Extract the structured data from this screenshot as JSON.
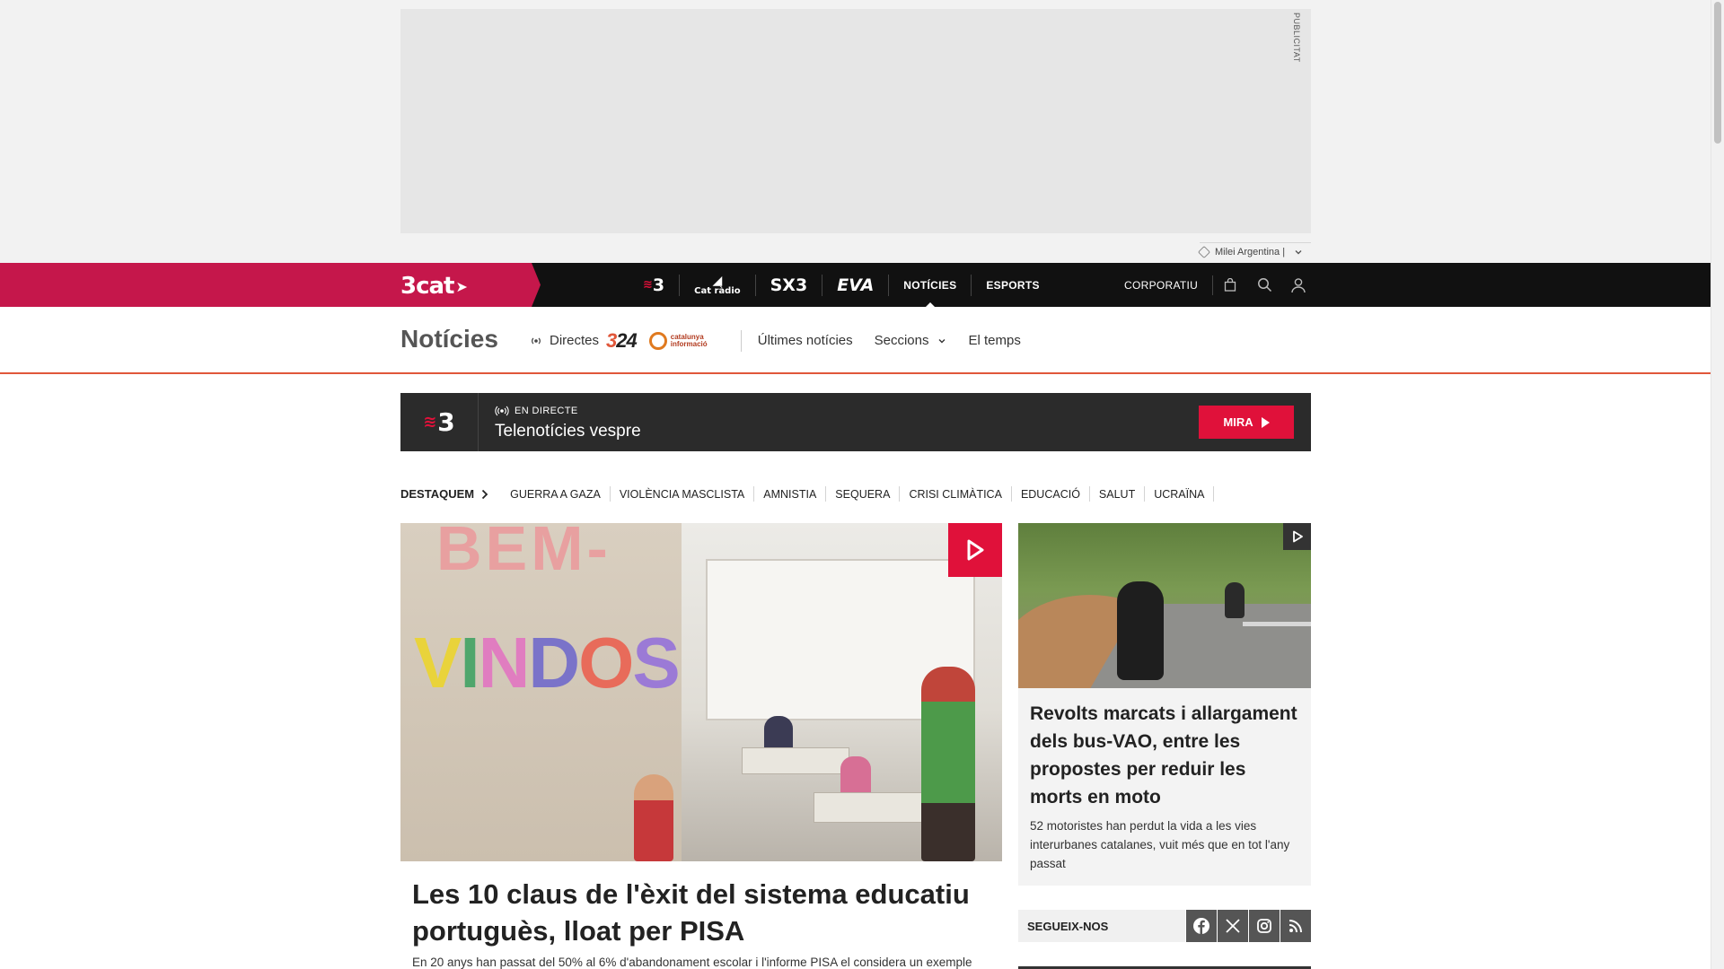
{
  "ad": {
    "label": "PUBLICITAT",
    "topic": "Milei Argentina |"
  },
  "topnav": {
    "brand": "3cat",
    "channels": [
      {
        "label": "3",
        "icon": "tv3-logo-icon"
      },
      {
        "label": "Cat ràdio",
        "icon": "catradio-logo-icon"
      },
      {
        "label": "SX3",
        "icon": "sx3-logo-icon"
      },
      {
        "label": "EVA",
        "icon": "eva-logo-icon"
      }
    ],
    "links": [
      {
        "label": "NOTÍCIES",
        "active": true
      },
      {
        "label": "ESPORTS",
        "active": false
      }
    ],
    "corporate": "CORPORATIU"
  },
  "section": {
    "title": "Notícies",
    "live_label": "Directes",
    "logo_324": "324",
    "logo_ci": "catalunya informació",
    "links": [
      "Últimes notícies",
      "Seccions",
      "El temps"
    ]
  },
  "live": {
    "channel": "3",
    "status": "EN DIRECTE",
    "program": "Telenotícies vespre",
    "button": "MIRA"
  },
  "destaquem": {
    "label": "DESTAQUEM",
    "tags": [
      "GUERRA A GAZA",
      "VIOLÈNCIA MASCLISTA",
      "AMNISTIA",
      "SEQUERA",
      "CRISI CLIMÀTICA",
      "EDUCACIÓ",
      "SALUT",
      "UCRAÏNA"
    ]
  },
  "main_article": {
    "image_letters_top": "BEM-",
    "image_letters_bottom": [
      "V",
      "I",
      "N",
      "D",
      "O",
      "S"
    ],
    "title": "Les 10 claus de l'èxit del sistema educatiu portuguès, lloat per PISA",
    "summary": "En 20 anys han passat del 50% al 6% d'abandonament escolar i l'informe PISA el considera un exemple"
  },
  "side_article": {
    "title": "Revolts marcats i allargament dels bus-VAO, entre les propostes per reduir les morts en moto",
    "summary": "52 motoristes han perdut la vida a les vies interurbanes catalanes, vuit més que en tot l'any passat"
  },
  "follow": {
    "label": "SEGUEIX-NOS",
    "networks": [
      "facebook-icon",
      "x-icon",
      "instagram-icon",
      "rss-icon"
    ]
  },
  "colors": {
    "brand": "#c5174b",
    "live_red": "#e0113a",
    "accent_orange": "#e0573a",
    "nav_bg": "#111111"
  }
}
